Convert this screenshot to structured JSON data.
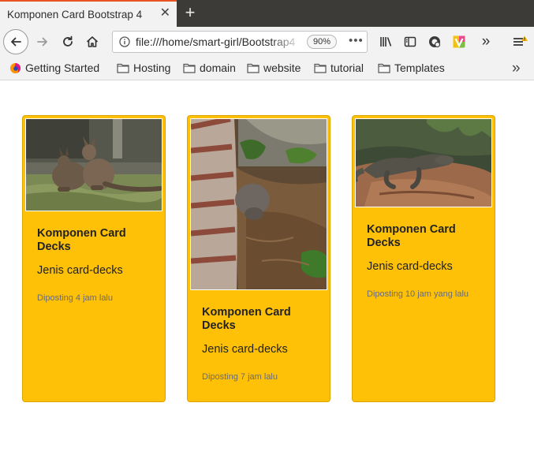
{
  "browser": {
    "tab_title": "Komponen Card Bootstrap 4",
    "tab_close": "✕",
    "new_tab": "+",
    "url": "file:///home/smart-girl/Bootstrap4",
    "zoom": "90%",
    "page_actions": "•••",
    "overflow": "»"
  },
  "bookmarks": [
    {
      "label": "Getting Started",
      "icon": "firefox-icon"
    },
    {
      "label": "Hosting",
      "icon": "folder-icon"
    },
    {
      "label": "domain",
      "icon": "folder-icon"
    },
    {
      "label": "website",
      "icon": "folder-icon"
    },
    {
      "label": "tutorial",
      "icon": "folder-icon"
    },
    {
      "label": "Templates",
      "icon": "folder-icon"
    }
  ],
  "cards": [
    {
      "title": "Komponen Card Decks",
      "text": "Jenis card-decks",
      "time": "Diposting 4 jam lalu",
      "image": "wallaby-photo"
    },
    {
      "title": "Komponen Card Decks",
      "text": "Jenis card-decks",
      "time": "Diposting 7 jam lalu",
      "image": "porcupine-photo"
    },
    {
      "title": "Komponen Card Decks",
      "text": "Jenis card-decks",
      "time": "Diposting 10 jam yang lalu",
      "image": "komodo-photo"
    }
  ],
  "colors": {
    "card_bg": "#ffc107",
    "tab_accent": "#e95420",
    "tabbar_bg": "#3c3b37"
  }
}
